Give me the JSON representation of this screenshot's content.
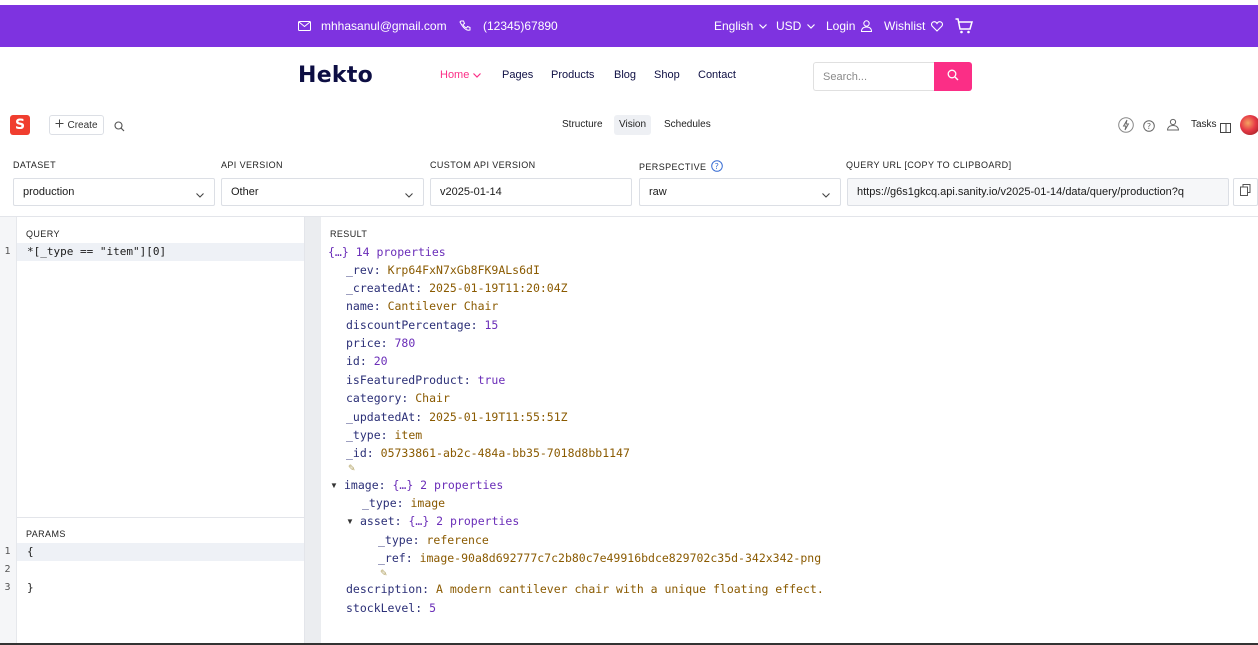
{
  "topbar": {
    "email": "mhhasanul@gmail.com",
    "phone": "(12345)67890",
    "language": "English",
    "currency": "USD",
    "login": "Login",
    "wishlist": "Wishlist",
    "bg_color": "#7e33e0"
  },
  "header": {
    "logo": "Hekto",
    "nav": [
      "Home",
      "Pages",
      "Products",
      "Blog",
      "Shop",
      "Contact"
    ],
    "active_nav": "Home",
    "search_placeholder": "Search...",
    "accent_color": "#fb2e86"
  },
  "studio": {
    "create_label": "Create",
    "tools": [
      "Structure",
      "Vision",
      "Schedules"
    ],
    "active_tool": "Vision",
    "tasks_label": "Tasks"
  },
  "fields": {
    "dataset": {
      "label": "DATASET",
      "value": "production"
    },
    "api_version": {
      "label": "API VERSION",
      "value": "Other"
    },
    "custom_api_version": {
      "label": "CUSTOM API VERSION",
      "value": "v2025-01-14"
    },
    "perspective": {
      "label": "PERSPECTIVE",
      "value": "raw"
    },
    "query_url": {
      "label": "QUERY URL [COPY TO CLIPBOARD]",
      "value": "https://g6s1gkcq.api.sanity.io/v2025-01-14/data/query/production?q"
    }
  },
  "query": {
    "label": "QUERY",
    "lines": [
      "*[_type == \"item\"][0]"
    ]
  },
  "params": {
    "label": "PARAMS",
    "lines": [
      "{",
      "",
      "}"
    ]
  },
  "result": {
    "label": "RESULT",
    "root_summary": "{…} 14 properties",
    "rows": [
      {
        "key": "_rev",
        "value": "Krp64FxN7xGb8FK9ALs6dI"
      },
      {
        "key": "_createdAt",
        "value": "2025-01-19T11:20:04Z"
      },
      {
        "key": "name",
        "value": "Cantilever Chair"
      },
      {
        "key": "discountPercentage",
        "value": "15"
      },
      {
        "key": "price",
        "value": "780"
      },
      {
        "key": "id",
        "value": "20"
      },
      {
        "key": "isFeaturedProduct",
        "value": "true"
      },
      {
        "key": "category",
        "value": "Chair"
      },
      {
        "key": "_updatedAt",
        "value": "2025-01-19T11:55:51Z"
      },
      {
        "key": "_type",
        "value": "item"
      },
      {
        "key": "_id",
        "value": "05733861-ab2c-484a-bb35-7018d8bb1147"
      }
    ],
    "image": {
      "key": "image",
      "summary": "{…} 2 properties",
      "type_key": "_type",
      "type_value": "image",
      "asset": {
        "key": "asset",
        "summary": "{…} 2 properties",
        "type_key": "_type",
        "type_value": "reference",
        "ref_key": "_ref",
        "ref_value": "image-90a8d692777c7c2b80c7e49916bdce829702c35d-342x342-png"
      }
    },
    "tail_rows": [
      {
        "key": "description",
        "value": "A modern cantilever chair with a unique floating effect."
      },
      {
        "key": "stockLevel",
        "value": "5"
      }
    ]
  }
}
